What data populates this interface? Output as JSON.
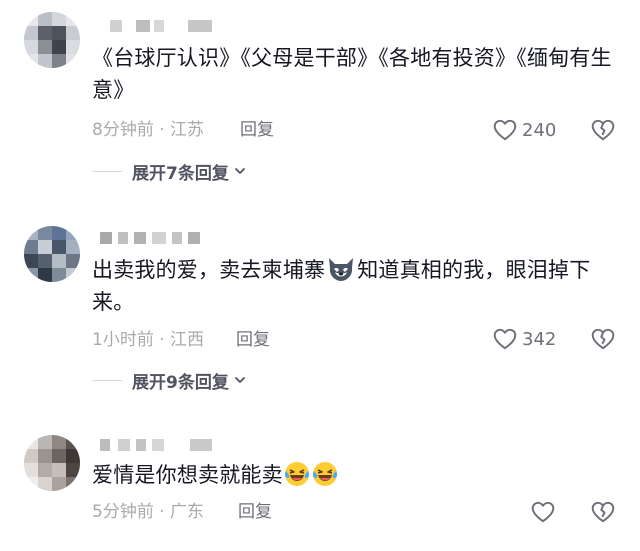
{
  "comments": [
    {
      "text": "《台球厅认识》《父母是干部》《各地有投资》《缅甸有生意》",
      "time_location": "8分钟前 · 江苏",
      "reply_label": "回复",
      "likes": "240",
      "expand_label": "展开7条回复"
    },
    {
      "text_before": "出卖我的爱，卖去柬埔寨",
      "text_after": "知道真相的我，眼泪掉下来。",
      "emoji": "wolf-face-emoji",
      "time_location": "1小时前 · 江西",
      "reply_label": "回复",
      "likes": "342",
      "expand_label": "展开9条回复"
    },
    {
      "text": "爱情是你想卖就能卖",
      "emojis": [
        "laughing-crying-emoji",
        "laughing-crying-emoji"
      ],
      "time_location": "5分钟前 · 广东",
      "reply_label": "回复"
    }
  ],
  "icons": {
    "like": "heart-outline-icon",
    "dislike": "broken-heart-icon",
    "expand": "chevron-down-icon"
  },
  "colors": {
    "text": "#161823",
    "meta": "#a9aaae",
    "reply": "#6e7079",
    "expand": "#525361"
  }
}
